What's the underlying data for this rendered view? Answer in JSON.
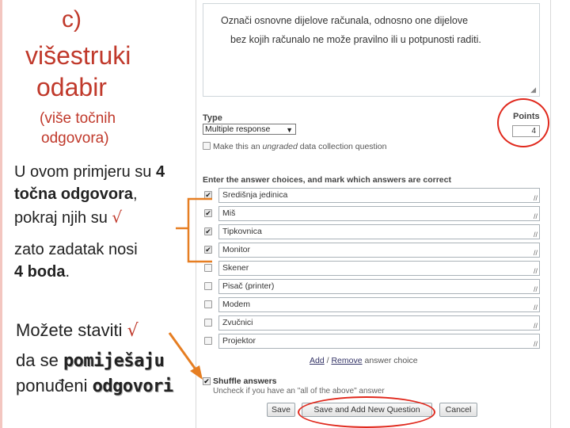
{
  "left": {
    "title_line1": "c)",
    "title_line2": "višestruki",
    "title_line3": "odabir",
    "subtitle_line1": "(više točnih",
    "subtitle_line2": "odgovora)",
    "example_line1_a": "U ovom primjeru su ",
    "example_line1_b": "4",
    "example_line2_a": "točna odgovora",
    "example_line2_b": ",",
    "example_line3": "pokraj njih su ",
    "check_symbol": "√",
    "example_line4": "zato zadatak nosi",
    "example_line5_a": "4 boda",
    "example_line5_b": ".",
    "tip_line1": "Možete staviti ",
    "tip_line2_a": "da se ",
    "tip_line2_b": "pomiješaju",
    "tip_line3_a": "ponuđeni ",
    "tip_line3_b": "odgovori"
  },
  "form": {
    "question_line1": "Označi osnovne dijelove računala, odnosno one dijelove",
    "question_line2": "bez kojih računalo ne može pravilno ili u potpunosti raditi.",
    "type_label": "Type",
    "type_value": "Multiple response",
    "ungraded_a": "Make this an ",
    "ungraded_b": "ungraded",
    "ungraded_c": " data collection question",
    "points_label": "Points",
    "points_value": "4",
    "choices_label": "Enter the answer choices, and mark which answers are correct",
    "answers": [
      {
        "text": "Središnja jedinica",
        "checked": true
      },
      {
        "text": "Miš",
        "checked": true
      },
      {
        "text": "Tipkovnica",
        "checked": true
      },
      {
        "text": "Monitor",
        "checked": true
      },
      {
        "text": "Skener",
        "checked": false
      },
      {
        "text": "Pisač (printer)",
        "checked": false
      },
      {
        "text": "Modem",
        "checked": false
      },
      {
        "text": "Zvučnici",
        "checked": false
      },
      {
        "text": "Projektor",
        "checked": false
      }
    ],
    "add_link": "Add",
    "separator": " / ",
    "remove_link": "Remove",
    "answer_choice_text": " answer choice",
    "shuffle_label": "Shuffle answers",
    "shuffle_hint": "Uncheck if you have an \"all of the above\" answer",
    "save_label": "Save",
    "save_add_label": "Save and Add New Question",
    "cancel_label": "Cancel"
  },
  "colors": {
    "title_red": "#c0392b",
    "annotation_orange": "#e67e22",
    "annotation_ring_red": "#e0281c"
  }
}
